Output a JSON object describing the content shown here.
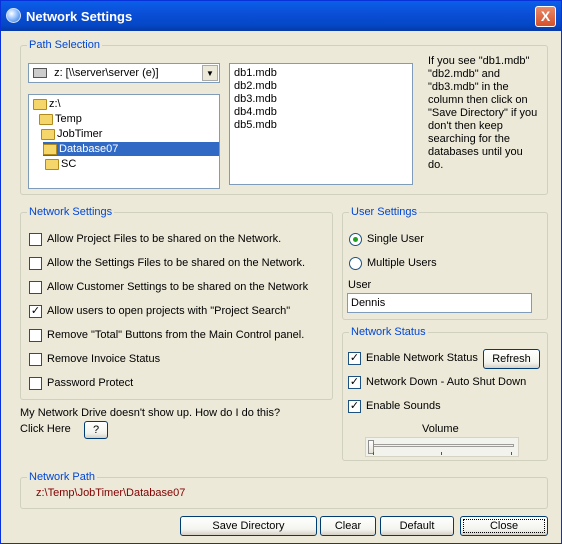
{
  "window": {
    "title": "Network Settings",
    "close_label": "X"
  },
  "path_selection": {
    "legend": "Path Selection",
    "drive_value": "z: [\\\\server\\server (e)]",
    "folders": [
      "z:\\",
      "Temp",
      "JobTimer",
      "Database07",
      "SC"
    ],
    "selected_folder": "Database07",
    "files": [
      "db1.mdb",
      "db2.mdb",
      "db3.mdb",
      "db4.mdb",
      "db5.mdb"
    ],
    "help_text": "If you see \"db1.mdb\" \"db2.mdb\" and \"db3.mdb\" in the column then click on \"Save Directory\" if you don't then keep searching for the databases until you do."
  },
  "network_settings": {
    "legend": "Network Settings",
    "options": [
      {
        "label": "Allow Project Files to be shared on the Network.",
        "checked": false
      },
      {
        "label": "Allow the Settings Files to be shared on the Network.",
        "checked": false
      },
      {
        "label": "Allow Customer Settings to be shared on the Network",
        "checked": false
      },
      {
        "label": "Allow users to open projects with \"Project Search\"",
        "checked": true
      },
      {
        "label": "Remove \"Total\" Buttons from the Main Control panel.",
        "checked": false
      },
      {
        "label": "Remove Invoice Status",
        "checked": false
      },
      {
        "label": "Password Protect",
        "checked": false
      }
    ]
  },
  "help": {
    "question": "My Network Drive doesn't show up. How do I do this?",
    "click_here": "Click Here",
    "help_button": "?"
  },
  "user_settings": {
    "legend": "User Settings",
    "single_user": "Single User",
    "multiple_users": "Multiple Users",
    "mode": "single",
    "user_label": "User",
    "user_value": "Dennis"
  },
  "network_status": {
    "legend": "Network Status",
    "enable_network_status": "Enable Network Status",
    "enable_network_status_checked": true,
    "refresh_label": "Refresh",
    "network_down": "Network Down - Auto Shut Down",
    "network_down_checked": true,
    "enable_sounds": "Enable Sounds",
    "enable_sounds_checked": true,
    "volume_label": "Volume",
    "volume_level": 0.0
  },
  "network_path": {
    "legend": "Network Path",
    "value": "z:\\Temp\\JobTimer\\Database07",
    "value_color": "#800000"
  },
  "buttons": {
    "save_directory": "Save Directory",
    "clear": "Clear",
    "default": "Default",
    "close": "Close"
  }
}
